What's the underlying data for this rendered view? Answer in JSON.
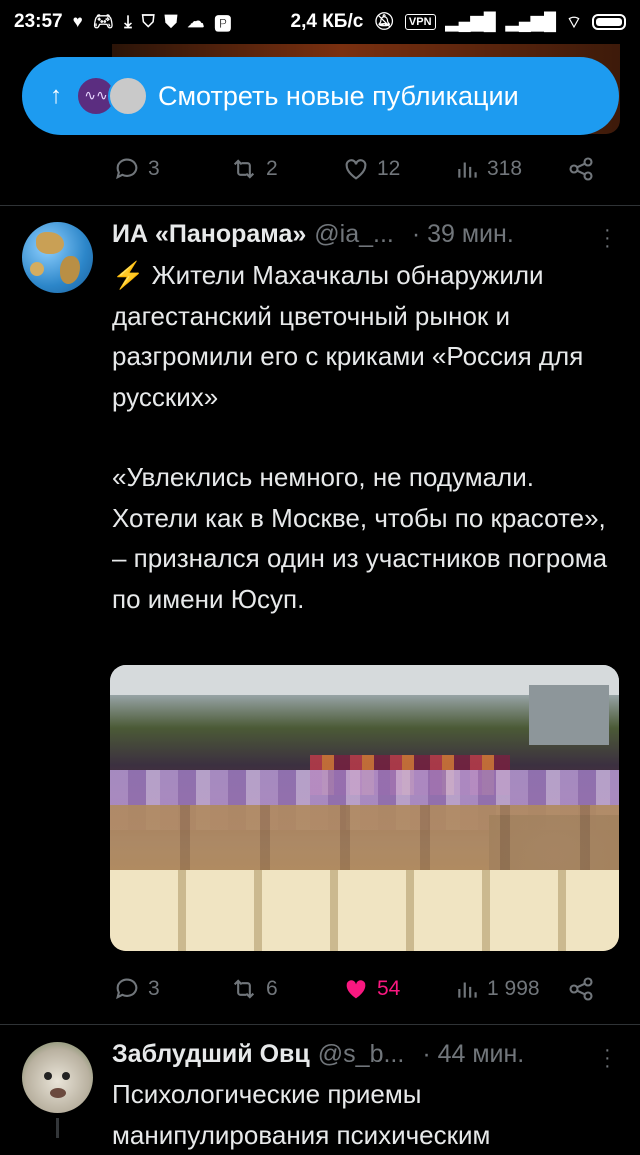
{
  "status_bar": {
    "time": "23:57",
    "network_speed": "2,4 КБ/с",
    "vpn_label": "VPN",
    "left_icons": [
      "heart-icon",
      "gamepad-icon",
      "download-icon",
      "shield-icon",
      "shield-icon",
      "cloud-icon",
      "parking-icon"
    ],
    "right_icons": [
      "mute-icon",
      "vpn-icon",
      "signal-icon",
      "signal-icon",
      "wifi-icon",
      "battery-icon"
    ]
  },
  "new_posts_pill": {
    "label": "Смотреть новые публикации",
    "arrow": "↑"
  },
  "previous_tweet": {
    "replies": "3",
    "retweets": "2",
    "likes": "12",
    "views": "318"
  },
  "tweet1": {
    "author_name": "ИА «Панорама»",
    "author_handle": "@ia_...",
    "time": "· 39 мин.",
    "text_paragraph1": "⚡ Жители Махачкалы обнаружили дагестанский цветочный рынок и разгромили его с криками «Россия для русских»",
    "text_paragraph2": "«Увлеклись немного, не подумали. Хотели как в Москве, чтобы по красоте», – признался один из участников погрома по имени Юсуп.",
    "replies": "3",
    "retweets": "6",
    "likes": "54",
    "liked": true,
    "views": "1 998",
    "colors": {
      "like": "#f91880",
      "accent": "#1d9bf0"
    }
  },
  "tweet2": {
    "author_name": "Заблудший Овц",
    "author_handle": "@s_b...",
    "time": "· 44 мин.",
    "text": "Психологические приемы манипулирования психическим"
  }
}
